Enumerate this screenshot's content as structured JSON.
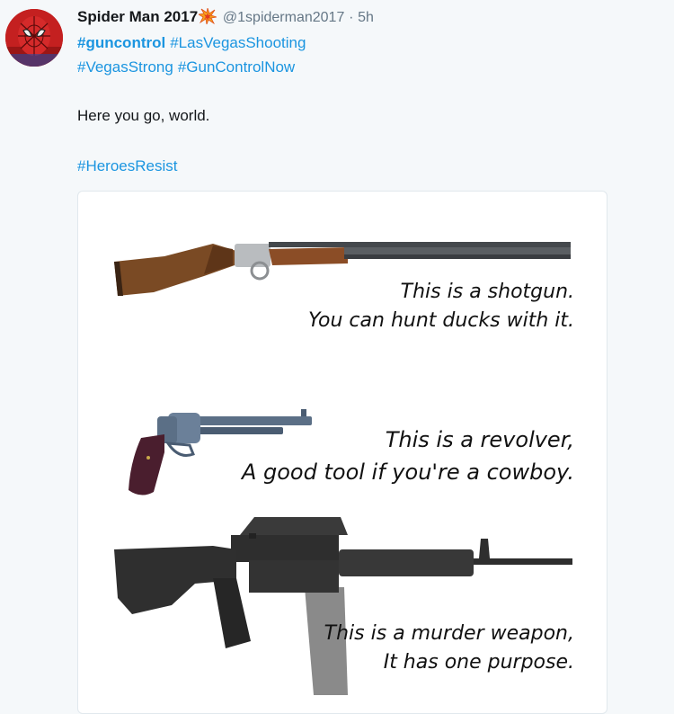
{
  "tweet": {
    "display_name": "Spider Man 2017",
    "badge_icon": "explosion-icon",
    "handle": "@1spiderman2017",
    "separator": "·",
    "time": "5h",
    "hashtags_line1": [
      "#guncontrol",
      "#LasVegasShooting"
    ],
    "hashtags_line2": [
      "#VegasStrong",
      "#GunControlNow"
    ],
    "body": "Here you go, world.",
    "closing_hashtag": "#HeroesResist"
  },
  "image": {
    "captions": [
      {
        "line1": "This is a shotgun.",
        "line2": "You can hunt ducks with it."
      },
      {
        "line1": "This is a revolver,",
        "line2": "A good tool if you're a cowboy."
      },
      {
        "line1": "This is a murder weapon,",
        "line2": "It has one purpose."
      }
    ]
  },
  "colors": {
    "link": "#1b95e0",
    "page_bg": "#f5f8fa",
    "muted": "#657786"
  }
}
